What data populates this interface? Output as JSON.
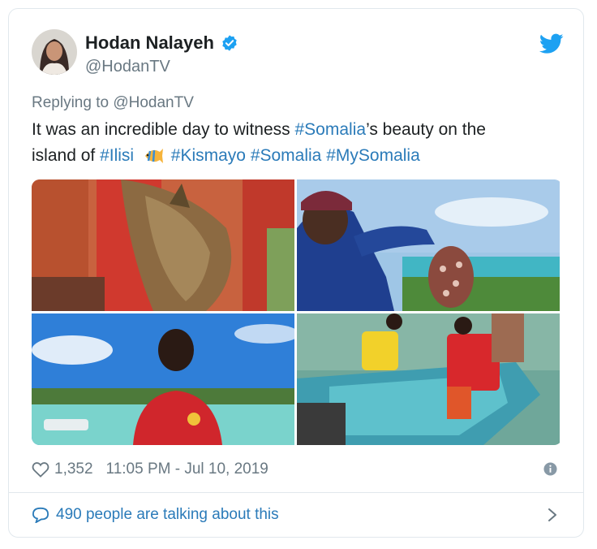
{
  "author": {
    "name": "Hodan Nalayeh",
    "handle": "@HodanTV",
    "verified": true
  },
  "reply": {
    "prefix": "Replying to",
    "mention": "@HodanTV"
  },
  "tweet": {
    "line1_a": "It was an incredible day to witness ",
    "line1_tag": "#Somalia",
    "line1_b": "’s beauty on the",
    "line2_a": "island of  ",
    "tag_ilisi": "#Ilisi",
    "tag_kismayo": "#Kismayo",
    "tag_somalia": "#Somalia",
    "tag_mysomalia": "#MySomalia"
  },
  "media": [
    {
      "icon": "fish-photo"
    },
    {
      "icon": "octopus-photo"
    },
    {
      "icon": "beach-portrait-photo"
    },
    {
      "icon": "boat-photo"
    }
  ],
  "footer": {
    "likes": "1,352",
    "timestamp": "11:05 PM - Jul 10, 2019",
    "talking": "490 people are talking about this"
  },
  "colors": {
    "link": "#2b7bb9",
    "muted": "#697882",
    "border": "#e1e8ed",
    "twitter_blue": "#1da1f2"
  }
}
